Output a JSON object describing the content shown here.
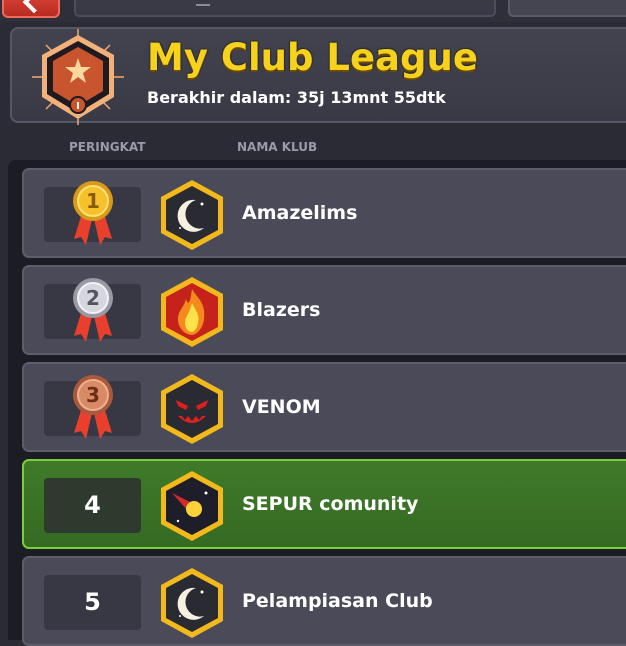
{
  "header": {
    "title": "My Club League",
    "subtitle": "Berakhir dalam: 35j 13mnt 55dtk",
    "league_badge_icon": "bronze-league-badge-icon",
    "league_tier_numeral": "I"
  },
  "columns": {
    "rank_label": "PERINGKAT",
    "club_label": "NAMA KLUB"
  },
  "colors": {
    "title": "#f6d21c",
    "highlight_row": "#3f7a2a",
    "highlight_border": "#7ccd3a",
    "row_bg": "#4a4a58"
  },
  "clubs": [
    {
      "rank": "1",
      "name": "Amazelims",
      "emblem": "moon-emblem-icon",
      "medal": "gold-medal-icon"
    },
    {
      "rank": "2",
      "name": "Blazers",
      "emblem": "flame-emblem-icon",
      "medal": "silver-medal-icon"
    },
    {
      "rank": "3",
      "name": "VENOM",
      "emblem": "demon-face-emblem-icon",
      "medal": "bronze-medal-icon"
    },
    {
      "rank": "4",
      "name": "SEPUR comunity",
      "emblem": "comet-emblem-icon",
      "medal": ""
    },
    {
      "rank": "5",
      "name": "Pelampiasan Club",
      "emblem": "moon-emblem-icon",
      "medal": ""
    }
  ]
}
